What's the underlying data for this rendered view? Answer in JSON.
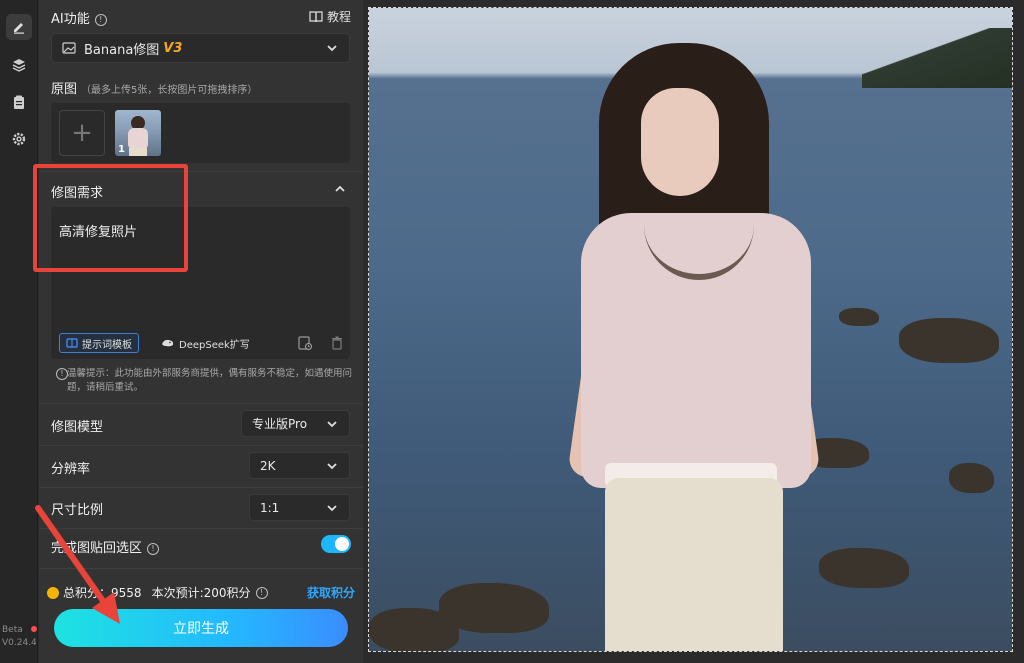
{
  "rail": {
    "icons": [
      "edit-icon",
      "layers-icon",
      "clipboard-icon",
      "gear-icon"
    ],
    "beta_label": "Beta",
    "version": "V0.24.4"
  },
  "panel": {
    "ai_feature_label": "AI功能",
    "tutorial_label": "教程",
    "model_select": {
      "name": "Banana修图",
      "badge": "V3"
    },
    "original": {
      "label": "原图",
      "hint": "（最多上传5张，长按图片可拖拽排序）",
      "thumb_index": "1"
    },
    "requirement": {
      "label": "修图需求",
      "text": "高清修复照片",
      "template_button": "提示词模板",
      "deepseek_button": "DeepSeek扩写"
    },
    "tip": "温馨提示：此功能由外部服务商提供，偶有服务不稳定，如遇使用问题，请稍后重试。",
    "retouch_model": {
      "label": "修图模型",
      "value": "专业版Pro"
    },
    "resolution": {
      "label": "分辨率",
      "value": "2K"
    },
    "aspect_ratio": {
      "label": "尺寸比例",
      "value": "1:1"
    },
    "paste_back": {
      "label": "完成图贴回选区",
      "enabled": true
    },
    "points": {
      "total_label": "总积分：",
      "total_value": "9558",
      "estimate": "本次预计:200积分"
    },
    "get_points": "获取积分",
    "generate_button": "立即生成"
  },
  "colors": {
    "accent": "#24b8ff",
    "highlight_box": "#e8443a",
    "badge": "#f5a623"
  }
}
